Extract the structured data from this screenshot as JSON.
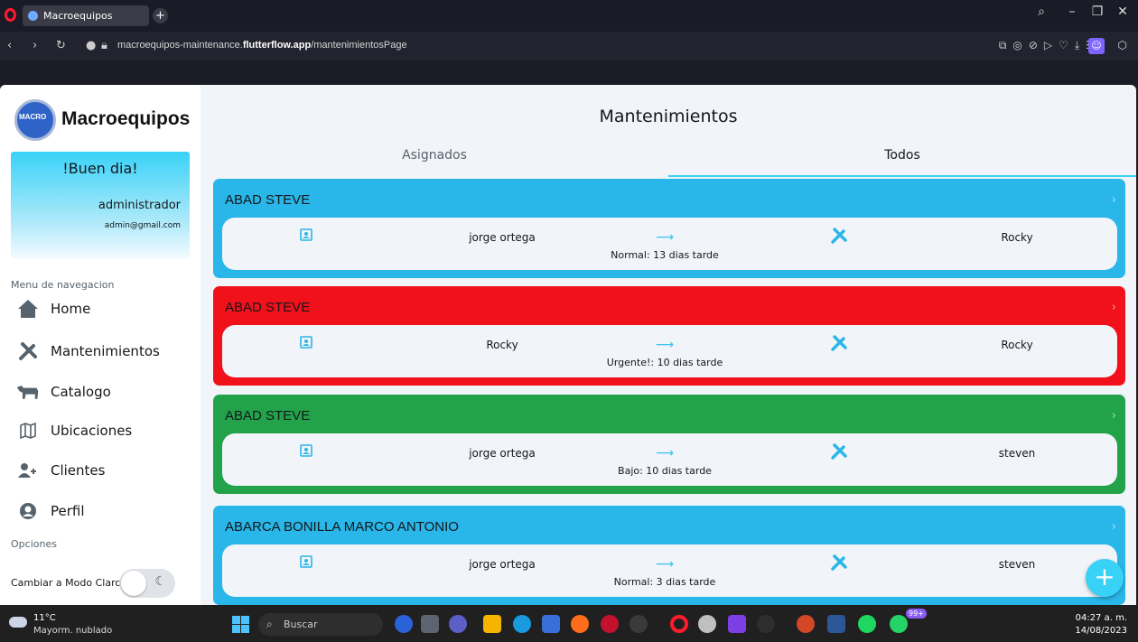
{
  "browser": {
    "tab_title": "Macroequipos",
    "url_prefix": "macroequipos-maintenance.",
    "url_domain": "flutterflow.app",
    "url_path": "/mantenimientosPage"
  },
  "sidebar": {
    "logo_text": "MACRO",
    "brand": "Macroequipos",
    "greeting": "!Buen dia!",
    "user_name": "administrador",
    "user_email": "admin@gmail.com",
    "menu_title": "Menu de navegacion",
    "items": [
      {
        "label": "Home",
        "icon": "home-icon"
      },
      {
        "label": "Mantenimientos",
        "icon": "tools-icon"
      },
      {
        "label": "Catalogo",
        "icon": "cow-icon"
      },
      {
        "label": "Ubicaciones",
        "icon": "map-icon"
      },
      {
        "label": "Clientes",
        "icon": "users-icon"
      },
      {
        "label": "Perfil",
        "icon": "profile-icon"
      }
    ],
    "options_title": "Opciones",
    "mode_label": "Cambiar a Modo Claro"
  },
  "main": {
    "title": "Mantenimientos",
    "tabs": [
      {
        "label": "Asignados",
        "active": false
      },
      {
        "label": "Todos",
        "active": true
      }
    ],
    "cards": [
      {
        "client": "ABAD STEVE",
        "technician": "jorge ortega",
        "status": "Normal: 13 dias tarde",
        "equipment": "Rocky",
        "color": "#29b6e8"
      },
      {
        "client": "ABAD STEVE",
        "technician": "Rocky",
        "status": "Urgente!: 10 dias tarde",
        "equipment": "Rocky",
        "color": "#f0111a"
      },
      {
        "client": "ABAD STEVE",
        "technician": "jorge ortega",
        "status": "Bajo: 10 dias tarde",
        "equipment": "steven",
        "color": "#22a34a"
      },
      {
        "client": "ABARCA BONILLA MARCO ANTONIO",
        "technician": "jorge ortega",
        "status": "Normal: 3 dias tarde",
        "equipment": "steven",
        "color": "#29b6e8"
      }
    ],
    "fab_label": "+"
  },
  "taskbar": {
    "weather_temp": "11°C",
    "weather_desc": "Mayorm. nublado",
    "search_placeholder": "Buscar",
    "notification_badge": "99+",
    "time": "04:27 a. m.",
    "date": "14/08/2023"
  },
  "colors": {
    "accent": "#39d2f7",
    "normal": "#29b6e8",
    "urgent": "#f0111a",
    "low": "#22a34a"
  }
}
